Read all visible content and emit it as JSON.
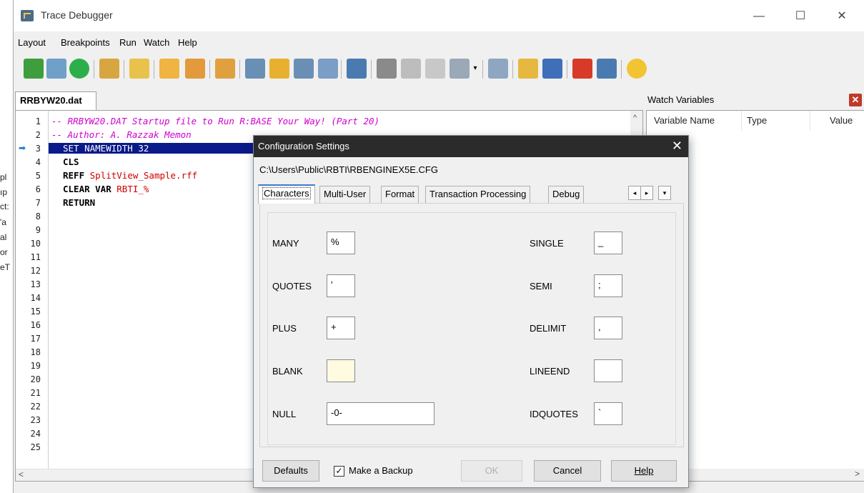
{
  "window": {
    "title": "Trace Debugger",
    "minimize_glyph": "—",
    "maximize_glyph": "☐",
    "close_glyph": "✕"
  },
  "menu": [
    "Layout",
    "Breakpoints",
    "Run",
    "Watch",
    "Help"
  ],
  "toolbar": {
    "icons": [
      "open-book-icon",
      "tree-icon",
      "go-icon",
      "database-icon",
      "folder-open-icon",
      "hand-stop-icon",
      "hand-remove-icon",
      "hand-clear-icon",
      "step-into-icon",
      "step-error-icon",
      "step-over-icon",
      "step-out-icon",
      "trace-window-icon",
      "binoculars-icon",
      "find-next-icon",
      "go-to-icon",
      "edit-pencil-icon",
      "dropdown-arrow-icon",
      "wand-icon",
      "open-file-icon",
      "save-icon",
      "breakpoint-icon",
      "exit-icon",
      "help-icon"
    ]
  },
  "editor": {
    "tab_label": "RRBYW20.dat",
    "line_numbers": [
      "1",
      "2",
      "3",
      "4",
      "5",
      "6",
      "7",
      "8",
      "9",
      "10",
      "11",
      "12",
      "13",
      "14",
      "15",
      "16",
      "17",
      "18",
      "19",
      "20",
      "21",
      "22",
      "23",
      "24",
      "25"
    ],
    "current_line_marker": "➡",
    "lines": {
      "l1": "-- RRBYW20.DAT Startup file to Run R:BASE Your Way! (Part 20)",
      "l2": "-- Author: A. Razzak Memon",
      "l3": "SET NAMEWIDTH 32",
      "l4": "CLS",
      "l5_kw": "REFF",
      "l5_val": "SplitView_Sample.rff",
      "l6_kw": "CLEAR VAR",
      "l6_val": "RBTI_%",
      "l7": "RETURN"
    },
    "scroll_up": "^",
    "scroll_left": "<",
    "scroll_right": ">"
  },
  "watch": {
    "title": "Watch Variables",
    "close_glyph": "✕",
    "columns": [
      "Variable Name",
      "Type",
      "Value"
    ]
  },
  "dialog": {
    "title": "Configuration Settings",
    "close_glyph": "✕",
    "path": "C:\\Users\\Public\\RBTI\\RBENGINEX5E.CFG",
    "tabs": [
      "Characters",
      "Multi-User",
      "Format",
      "Transaction Processing",
      "Debug"
    ],
    "tab_scroll": [
      "◂",
      "▸",
      "▾"
    ],
    "fields_left": [
      {
        "label": "MANY",
        "value": "%"
      },
      {
        "label": "QUOTES",
        "value": "'"
      },
      {
        "label": "PLUS",
        "value": "+"
      },
      {
        "label": "BLANK",
        "value": ""
      },
      {
        "label": "NULL",
        "value": "-0-"
      }
    ],
    "fields_right": [
      {
        "label": "SINGLE",
        "value": "_"
      },
      {
        "label": "SEMI",
        "value": ";"
      },
      {
        "label": "DELIMIT",
        "value": ","
      },
      {
        "label": "LINEEND",
        "value": ""
      },
      {
        "label": "IDQUOTES",
        "value": "`"
      }
    ],
    "buttons": {
      "defaults": "Defaults",
      "make_backup": "Make a Backup",
      "make_backup_checked": true,
      "check_glyph": "✓",
      "ok": "OK",
      "cancel": "Cancel",
      "help": "Help"
    }
  },
  "background_fragments": [
    "pl",
    "ıp",
    "ct:",
    "'a",
    "al",
    "or",
    "eT"
  ]
}
